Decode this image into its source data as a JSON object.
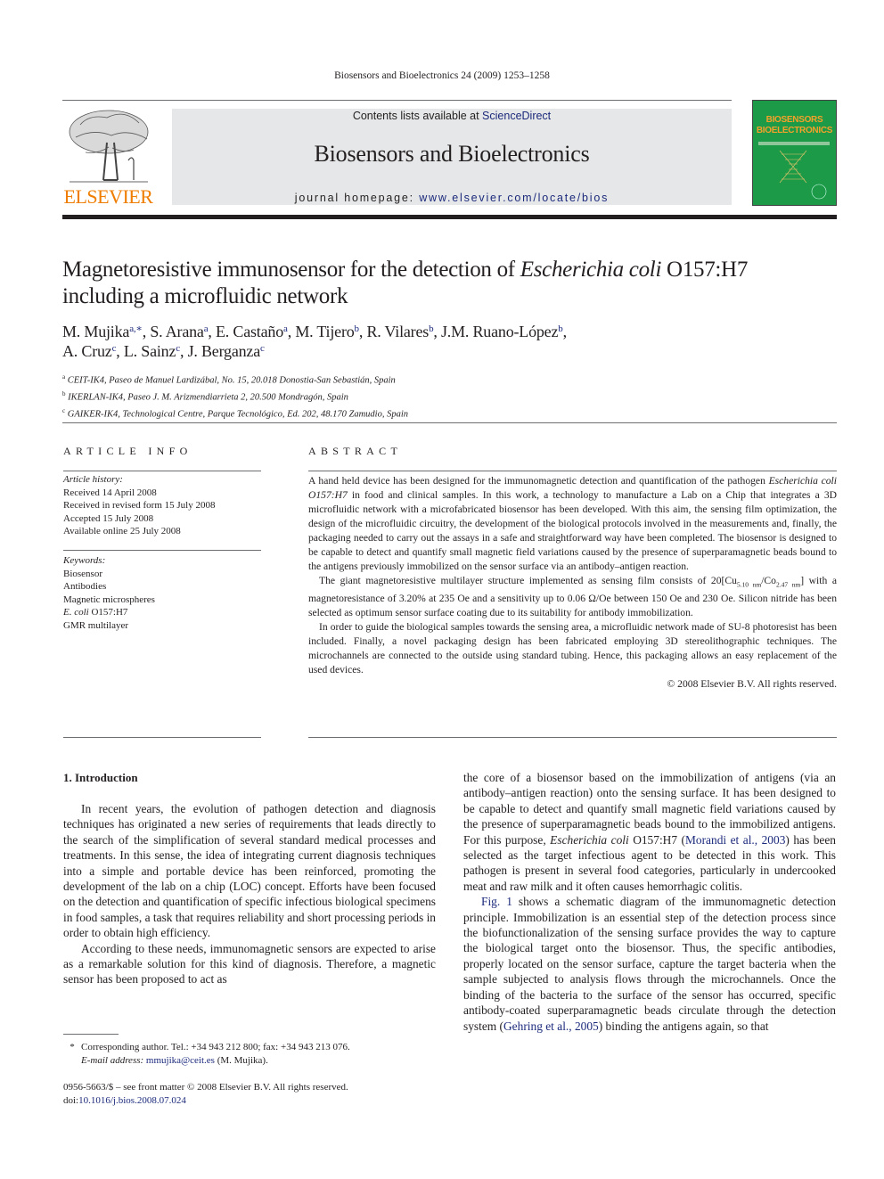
{
  "running_head": "Biosensors and Bioelectronics 24 (2009) 1253–1258",
  "header": {
    "publisher_logo_text": "ELSEVIER",
    "contents_prefix": "Contents lists available at ",
    "contents_link": "ScienceDirect",
    "journal_name": "Biosensors and Bioelectronics",
    "homepage_prefix": "journal homepage: ",
    "homepage_link": "www.elsevier.com/locate/bios",
    "cover_title_line1": "BIOSENSORS",
    "cover_title_line2": "BIOELECTRONICS",
    "brand_color": "#ef7d00",
    "cover_color": "#1d9a48",
    "link_color": "#1c2a7c"
  },
  "article": {
    "title_part1": "Magnetoresistive immunosensor for the detection of ",
    "title_italic": "Escherichia coli",
    "title_part2": " O157:H7",
    "title_line2": "including a microfluidic network",
    "authors": [
      {
        "name": "M. Mujika",
        "aff": "a,∗",
        "sep": ", "
      },
      {
        "name": "S. Arana",
        "aff": "a",
        "sep": ", "
      },
      {
        "name": "E. Castaño",
        "aff": "a",
        "sep": ", "
      },
      {
        "name": "M. Tijero",
        "aff": "b",
        "sep": ", "
      },
      {
        "name": "R. Vilares",
        "aff": "b",
        "sep": ", "
      },
      {
        "name": "J.M. Ruano-López",
        "aff": "b",
        "sep": ","
      },
      {
        "name": "A. Cruz",
        "aff": "c",
        "sep": ", "
      },
      {
        "name": "L. Sainz",
        "aff": "c",
        "sep": ", "
      },
      {
        "name": "J. Berganza",
        "aff": "c",
        "sep": ""
      }
    ],
    "affiliations": [
      {
        "key": "a",
        "text": "CEIT-IK4, Paseo de Manuel Lardizábal, No. 15, 20.018 Donostia-San Sebastián, Spain"
      },
      {
        "key": "b",
        "text": "IKERLAN-IK4, Paseo J. M. Arizmendiarrieta 2, 20.500 Mondragón, Spain"
      },
      {
        "key": "c",
        "text": "GAIKER-IK4, Technological Centre, Parque Tecnológico, Ed. 202, 48.170 Zamudio, Spain"
      }
    ]
  },
  "article_info": {
    "heading": "ARTICLE INFO",
    "history_label": "Article history:",
    "history": [
      "Received 14 April 2008",
      "Received in revised form 15 July 2008",
      "Accepted 15 July 2008",
      "Available online 25 July 2008"
    ],
    "keywords_label": "Keywords:",
    "keywords": {
      "k1": "Biosensor",
      "k2": "Antibodies",
      "k3": "Magnetic microspheres",
      "k4_italic": "E. coli",
      "k4_rest": " O157:H7",
      "k5": "GMR multilayer"
    }
  },
  "abstract": {
    "heading": "ABSTRACT",
    "p1_a": "A hand held device has been designed for the immunomagnetic detection and quantification of the pathogen ",
    "p1_italic": "Escherichia coli O157:H7",
    "p1_b": " in food and clinical samples. In this work, a technology to manufac­ture a Lab on a Chip that integrates a 3D microfluidic network with a microfabricated biosensor has been developed. With this aim, the sensing film optimization, the design of the microfluidic circuitry, the devel­opment of the biological protocols involved in the measurements and, finally, the packaging needed to carry out the assays in a safe and straightforward way have been completed. The biosensor is designed to be capable to detect and quantify small magnetic field variations caused by the presence of superparamag­netic beads bound to the antigens previously immobilized on the sensor surface via an antibody–antigen reaction.",
    "p2_a": "The giant magnetoresistive multilayer structure implemented as sensing film consists of 20[Cu",
    "p2_sub1": "5.10 nm",
    "p2_b": "/Co",
    "p2_sub2": "2.47 nm",
    "p2_c": "] with a magnetoresistance of 3.20% at 235 Oe and a sensitivity up to 0.06 Ω/Oe between 150 Oe and 230 Oe. Silicon nitride has been selected as optimum sensor surface coating due to its suitability for antibody immobilization.",
    "p3": "In order to guide the biological samples towards the sensing area, a microfluidic network made of SU-8 photoresist has been included. Finally, a novel packaging design has been fabricated employing 3D stereolithographic techniques. The microchannels are connected to the outside using standard tubing. Hence, this packaging allows an easy replacement of the used devices.",
    "copyright": "© 2008 Elsevier B.V. All rights reserved."
  },
  "body": {
    "section_heading": "1.  Introduction",
    "left_p1": "In recent years, the evolution of pathogen detection and diag­nosis techniques has originated a new series of requirements that leads directly to the search of the simplification of several stan­dard medical processes and treatments. In this sense, the idea of integrating current diagnosis techniques into a simple and portable device has been reinforced, promoting the development of the lab on a chip (LOC) concept. Efforts have been focused on the detec­tion and quantification of specific infectious biological specimens in food samples, a task that requires reliability and short processing periods in order to obtain high efficiency.",
    "left_p2": "According to these needs, immunomagnetic sensors are expected to arise as a remarkable solution for this kind of diag­nosis. Therefore, a magnetic sensor has been proposed to act as",
    "right_p1_a": "the core of a biosensor based on the immobilization of antigens (via an antibody–antigen reaction) onto the sensing surface. It has been designed to be capable to detect and quantify small magnetic field variations caused by the presence of superparamagnetic beads bound to the immobilized antigens. For this purpose, ",
    "right_p1_italic1": "Escherichia coli",
    "right_p1_b": " O157:H7 (",
    "right_p1_cite": "Morandi et al., 2003",
    "right_p1_c": ") has been selected as the tar­get infectious agent to be detected in this work. This pathogen is present in several food categories, particularly in undercooked meat and raw milk and it often causes hemorrhagic colitis.",
    "right_p2_fig": "Fig. 1",
    "right_p2_a": " shows a schematic diagram of the immunomagnetic detec­tion principle. Immobilization is an essential step of the detection process since the biofunctionalization of the sensing surface pro­vides the way to capture the biological target onto the biosensor. Thus, the specific antibodies, properly located on the sensor sur­face, capture the target bacteria when the sample subjected to analysis flows through the microchannels. Once the binding of the bacteria to the surface of the sensor has occurred, specific antibody-coated superparamagnetic beads circulate through the detection system (",
    "right_p2_cite": "Gehring et al., 2005",
    "right_p2_b": ") binding the antigens again, so that"
  },
  "footnote": {
    "star": "*",
    "corresponding": "Corresponding author. Tel.: +34 943 212 800; fax: +34 943 213 076.",
    "email_label": "E-mail address: ",
    "email": "mmujika@ceit.es",
    "email_suffix": " (M. Mujika)."
  },
  "front_matter": {
    "issn_line": "0956-5663/$ – see front matter © 2008 Elsevier B.V. All rights reserved.",
    "doi_label": "doi:",
    "doi": "10.1016/j.bios.2008.07.024"
  }
}
